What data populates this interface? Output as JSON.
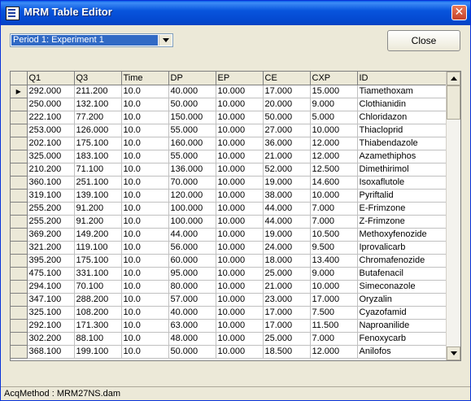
{
  "window": {
    "title": "MRM Table Editor",
    "close_symbol": "✕"
  },
  "period_select": {
    "value": "Period 1: Experiment 1"
  },
  "close_button": {
    "label": "Close"
  },
  "table": {
    "columns": [
      "Q1",
      "Q3",
      "Time",
      "DP",
      "EP",
      "CE",
      "CXP",
      "ID"
    ],
    "current_row_marker": "▶",
    "rows": [
      [
        "292.000",
        "211.200",
        "10.0",
        "40.000",
        "10.000",
        "17.000",
        "15.000",
        "Tiamethoxam"
      ],
      [
        "250.000",
        "132.100",
        "10.0",
        "50.000",
        "10.000",
        "20.000",
        "9.000",
        "Clothianidin"
      ],
      [
        "222.100",
        "77.200",
        "10.0",
        "150.000",
        "10.000",
        "50.000",
        "5.000",
        "Chloridazon"
      ],
      [
        "253.000",
        "126.000",
        "10.0",
        "55.000",
        "10.000",
        "27.000",
        "10.000",
        "Thiacloprid"
      ],
      [
        "202.100",
        "175.100",
        "10.0",
        "160.000",
        "10.000",
        "36.000",
        "12.000",
        "Thiabendazole"
      ],
      [
        "325.000",
        "183.100",
        "10.0",
        "55.000",
        "10.000",
        "21.000",
        "12.000",
        "Azamethiphos"
      ],
      [
        "210.200",
        "71.100",
        "10.0",
        "136.000",
        "10.000",
        "52.000",
        "12.500",
        "Dimethirimol"
      ],
      [
        "360.100",
        "251.100",
        "10.0",
        "70.000",
        "10.000",
        "19.000",
        "14.600",
        "Isoxaflutole"
      ],
      [
        "319.100",
        "139.100",
        "10.0",
        "120.000",
        "10.000",
        "38.000",
        "10.000",
        "Pyriftalid"
      ],
      [
        "255.200",
        "91.200",
        "10.0",
        "100.000",
        "10.000",
        "44.000",
        "7.000",
        "E-Frimzone"
      ],
      [
        "255.200",
        "91.200",
        "10.0",
        "100.000",
        "10.000",
        "44.000",
        "7.000",
        "Z-Frimzone"
      ],
      [
        "369.200",
        "149.200",
        "10.0",
        "44.000",
        "10.000",
        "19.000",
        "10.500",
        "Methoxyfenozide"
      ],
      [
        "321.200",
        "119.100",
        "10.0",
        "56.000",
        "10.000",
        "24.000",
        "9.500",
        "Iprovalicarb"
      ],
      [
        "395.200",
        "175.100",
        "10.0",
        "60.000",
        "10.000",
        "18.000",
        "13.400",
        "Chromafenozide"
      ],
      [
        "475.100",
        "331.100",
        "10.0",
        "95.000",
        "10.000",
        "25.000",
        "9.000",
        "Butafenacil"
      ],
      [
        "294.100",
        "70.100",
        "10.0",
        "80.000",
        "10.000",
        "21.000",
        "10.000",
        "Simeconazole"
      ],
      [
        "347.100",
        "288.200",
        "10.0",
        "57.000",
        "10.000",
        "23.000",
        "17.000",
        "Oryzalin"
      ],
      [
        "325.100",
        "108.200",
        "10.0",
        "40.000",
        "10.000",
        "17.000",
        "7.500",
        "Cyazofamid"
      ],
      [
        "292.100",
        "171.300",
        "10.0",
        "63.000",
        "10.000",
        "17.000",
        "11.500",
        "Naproanilide"
      ],
      [
        "302.200",
        "88.100",
        "10.0",
        "48.000",
        "10.000",
        "25.000",
        "7.000",
        "Fenoxycarb"
      ],
      [
        "368.100",
        "199.100",
        "10.0",
        "50.000",
        "10.000",
        "18.500",
        "12.000",
        "Anilofos"
      ]
    ]
  },
  "status_bar": {
    "text": "AcqMethod : MRM27NS.dam"
  },
  "icons": {
    "window_icon": "table-icon",
    "dropdown_arrow": "chevron-down-icon",
    "scroll_up": "arrow-up-icon",
    "scroll_down": "arrow-down-icon"
  },
  "colors": {
    "titlebar": "#0449d0",
    "selection": "#316ac5",
    "background": "#ece9d8"
  }
}
